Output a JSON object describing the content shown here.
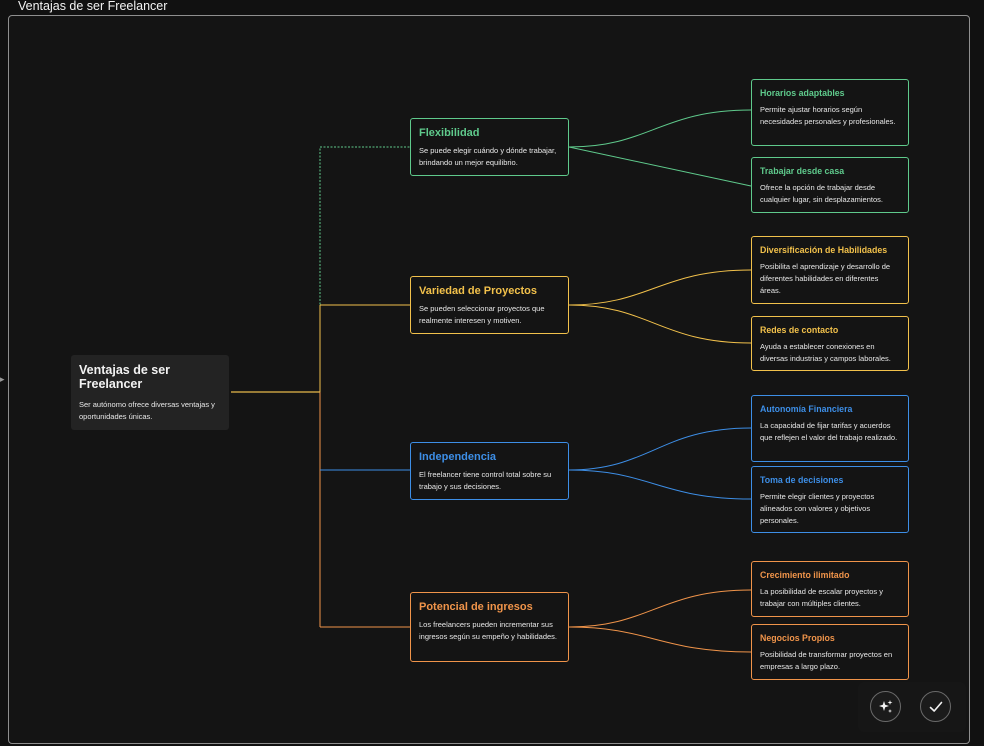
{
  "window": {
    "title": "Ventajas de ser Freelancer"
  },
  "colors": {
    "green": "#5fca8c",
    "yellow": "#f2c14b",
    "blue": "#3d8ee6",
    "orange": "#f0944a",
    "root_link": "#e8b94a"
  },
  "root": {
    "title": "Ventajas de ser Freelancer",
    "description": "Ser autónomo ofrece diversas ventajas y oportunidades únicas."
  },
  "branches": [
    {
      "title": "Flexibilidad",
      "description": "Se puede elegir cuándo y dónde trabajar, brindando un mejor equilibrio.",
      "color": "green",
      "children": [
        {
          "title": "Horarios adaptables",
          "description": "Permite ajustar horarios según necesidades personales y profesionales."
        },
        {
          "title": "Trabajar desde casa",
          "description": "Ofrece la opción de trabajar desde cualquier lugar, sin desplazamientos."
        }
      ]
    },
    {
      "title": "Variedad de Proyectos",
      "description": "Se pueden seleccionar proyectos que realmente interesen y motiven.",
      "color": "yellow",
      "children": [
        {
          "title": "Diversificación de Habilidades",
          "description": "Posibilita el aprendizaje y desarrollo de diferentes habilidades en diferentes áreas."
        },
        {
          "title": "Redes de contacto",
          "description": "Ayuda a establecer conexiones en diversas industrias y campos laborales."
        }
      ]
    },
    {
      "title": "Independencia",
      "description": "El freelancer tiene control total sobre su trabajo y sus decisiones.",
      "color": "blue",
      "children": [
        {
          "title": "Autonomía Financiera",
          "description": "La capacidad de fijar tarifas y acuerdos que reflejen el valor del trabajo realizado."
        },
        {
          "title": "Toma de decisiones",
          "description": "Permite elegir clientes y proyectos alineados con valores y objetivos personales."
        }
      ]
    },
    {
      "title": "Potencial de ingresos",
      "description": "Los freelancers pueden incrementar sus ingresos según su empeño y habilidades.",
      "color": "orange",
      "children": [
        {
          "title": "Crecimiento ilimitado",
          "description": "La posibilidad de escalar proyectos y trabajar con múltiples clientes."
        },
        {
          "title": "Negocios Propios",
          "description": "Posibilidad de transformar proyectos en empresas a largo plazo."
        }
      ]
    }
  ],
  "toolbar": {
    "magic_icon": "sparkles-icon",
    "confirm_icon": "check-icon"
  }
}
